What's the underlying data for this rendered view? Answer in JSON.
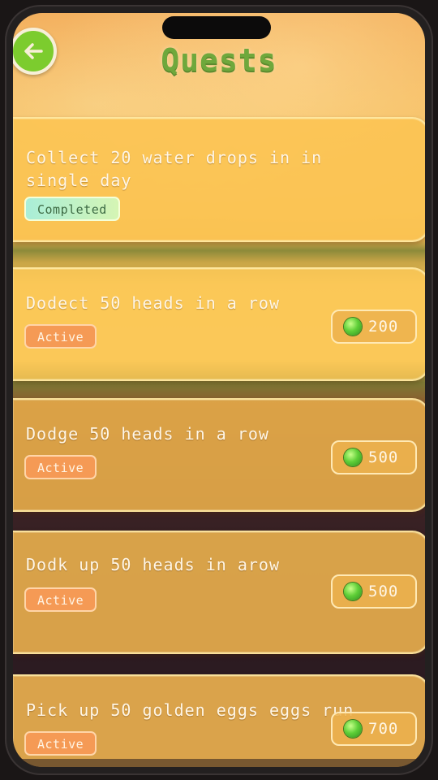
{
  "header": {
    "title": "Quests",
    "back_icon": "arrow-left-icon"
  },
  "quests": [
    {
      "text": "Collect 20 water drops in in single day",
      "status": "Completed",
      "reward": null
    },
    {
      "text": "Dodect 50 heads in a row",
      "status": "Active",
      "reward": "200"
    },
    {
      "text": "Dodge 50 heads in a row",
      "status": "Active",
      "reward": "500"
    },
    {
      "text": "Dodk up 50 heads in arow",
      "status": "Active",
      "reward": "500"
    },
    {
      "text": "Pick up 50 golden eggs eggs run",
      "status": "Active",
      "reward": "700"
    }
  ],
  "colors": {
    "title_green": "#6fa83c",
    "active_badge": "#f59a55",
    "completed_badge": "#a9eed8",
    "gem_green": "#5fcf38"
  }
}
